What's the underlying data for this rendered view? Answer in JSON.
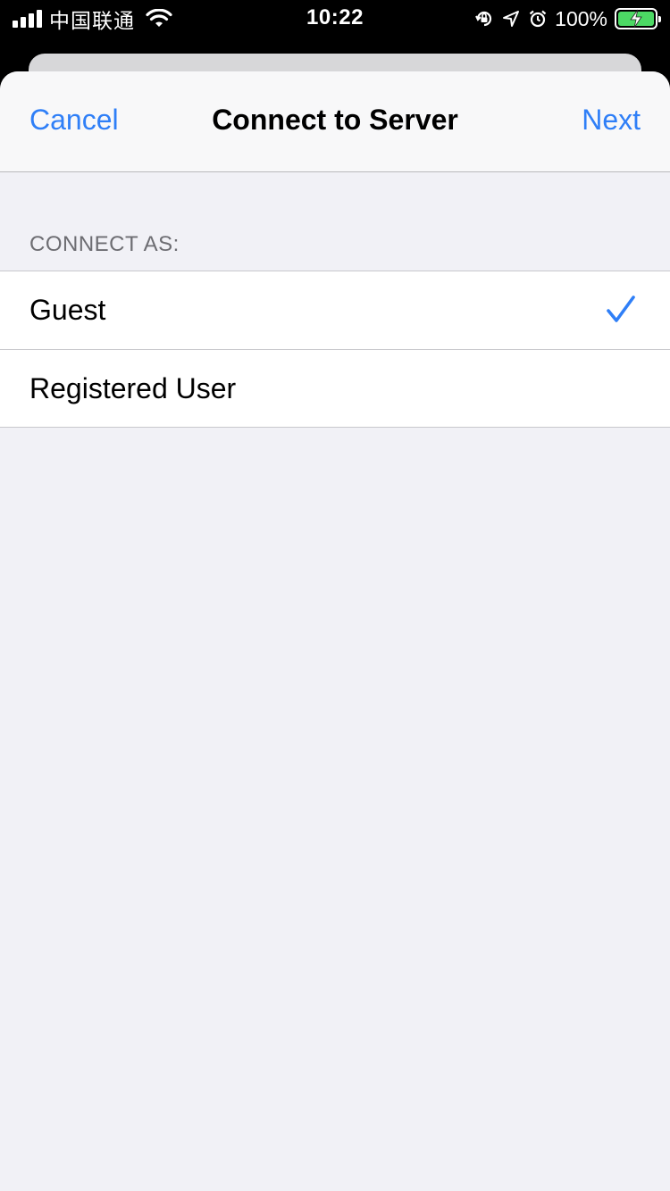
{
  "status_bar": {
    "carrier": "中国联通",
    "time": "10:22",
    "battery_percent": "100%",
    "battery_level": 1.0,
    "signal_bars": 4,
    "icons": [
      "signal-icon",
      "wifi-icon",
      "orientation-lock-icon",
      "location-icon",
      "alarm-icon",
      "battery-charging-icon"
    ]
  },
  "navbar": {
    "cancel_label": "Cancel",
    "title": "Connect to Server",
    "next_label": "Next"
  },
  "section": {
    "header": "CONNECT AS:",
    "options": [
      {
        "label": "Guest",
        "selected": true
      },
      {
        "label": "Registered User",
        "selected": false
      }
    ]
  },
  "colors": {
    "accent": "#2f7ff7",
    "background": "#f1f1f6",
    "battery_fill": "#4cd964"
  }
}
